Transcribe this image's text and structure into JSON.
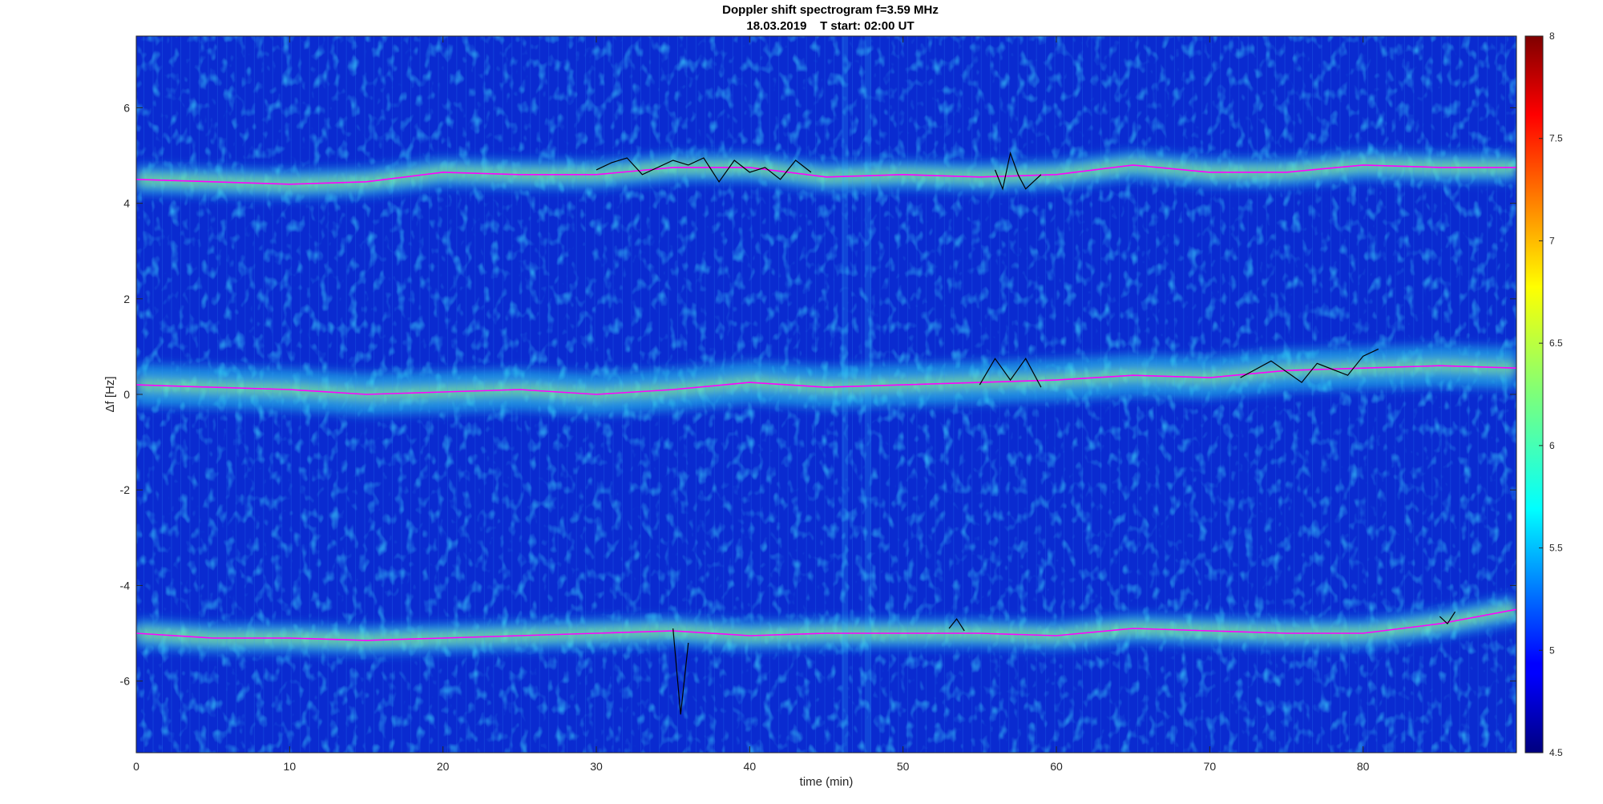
{
  "chart_data": {
    "type": "heatmap",
    "title": "Doppler shift spectrogram f=3.59 MHz",
    "subtitle": "18.03.2019    T start: 02:00 UT",
    "xlabel": "time (min)",
    "ylabel": "Δf [Hz]",
    "xlim": [
      0,
      90
    ],
    "ylim": [
      -7.5,
      7.5
    ],
    "x_ticks": [
      0,
      10,
      20,
      30,
      40,
      50,
      60,
      70,
      80
    ],
    "x_tick_labels": [
      "0",
      "10",
      "20",
      "30",
      "40",
      "50",
      "60",
      "70",
      "80"
    ],
    "y_ticks": [
      -6,
      -4,
      -2,
      0,
      2,
      4,
      6
    ],
    "y_tick_labels": [
      "-6",
      "-4",
      "-2",
      "0",
      "2",
      "4",
      "6"
    ],
    "colorbar": {
      "colormap": "jet",
      "clim": [
        4.5,
        8
      ],
      "ticks": [
        4.5,
        5,
        5.5,
        6,
        6.5,
        7,
        7.5,
        8
      ],
      "tick_labels": [
        "4.5",
        "5",
        "5.5",
        "6",
        "6.5",
        "7",
        "7.5",
        "8"
      ]
    },
    "series": [
      {
        "color": "#ff00ff",
        "x": [
          0,
          5,
          10,
          15,
          20,
          25,
          30,
          35,
          40,
          45,
          50,
          55,
          60,
          65,
          70,
          75,
          80,
          85,
          90
        ],
        "y": [
          4.5,
          4.45,
          4.4,
          4.45,
          4.65,
          4.6,
          4.6,
          4.75,
          4.75,
          4.55,
          4.6,
          4.55,
          4.6,
          4.8,
          4.65,
          4.65,
          4.8,
          4.75,
          4.75
        ]
      },
      {
        "color": "#ff00ff",
        "x": [
          0,
          5,
          10,
          15,
          20,
          25,
          30,
          35,
          40,
          45,
          50,
          55,
          60,
          65,
          70,
          75,
          80,
          85,
          90
        ],
        "y": [
          0.2,
          0.15,
          0.1,
          0.0,
          0.05,
          0.1,
          0.0,
          0.1,
          0.25,
          0.15,
          0.2,
          0.25,
          0.3,
          0.4,
          0.35,
          0.5,
          0.55,
          0.6,
          0.55
        ]
      },
      {
        "color": "#ff00ff",
        "x": [
          0,
          5,
          10,
          15,
          20,
          25,
          30,
          35,
          40,
          45,
          50,
          55,
          60,
          65,
          70,
          75,
          80,
          85,
          90
        ],
        "y": [
          -5.0,
          -5.1,
          -5.1,
          -5.15,
          -5.1,
          -5.05,
          -5.0,
          -4.95,
          -5.05,
          -5.0,
          -5.0,
          -5.0,
          -5.05,
          -4.9,
          -4.95,
          -5.0,
          -5.0,
          -4.8,
          -4.5
        ]
      },
      {
        "color": "#000000",
        "x": [
          30,
          31,
          32,
          33,
          35,
          36,
          37,
          38,
          39,
          40,
          41,
          42,
          43,
          44
        ],
        "y": [
          4.7,
          4.85,
          4.95,
          4.6,
          4.9,
          4.8,
          4.95,
          4.45,
          4.9,
          4.65,
          4.75,
          4.5,
          4.9,
          4.65
        ]
      },
      {
        "color": "#000000",
        "x": [
          35,
          35.5,
          36
        ],
        "y": [
          -4.9,
          -6.7,
          -5.2
        ]
      },
      {
        "color": "#000000",
        "x": [
          56,
          56.5,
          57,
          57.5,
          58,
          59
        ],
        "y": [
          4.7,
          4.3,
          5.05,
          4.6,
          4.3,
          4.6
        ]
      },
      {
        "color": "#000000",
        "x": [
          55,
          56,
          57,
          58,
          59
        ],
        "y": [
          0.2,
          0.75,
          0.3,
          0.75,
          0.15
        ]
      },
      {
        "color": "#000000",
        "x": [
          72,
          74,
          76,
          77,
          79,
          80,
          81
        ],
        "y": [
          0.35,
          0.7,
          0.25,
          0.65,
          0.4,
          0.8,
          0.95
        ]
      },
      {
        "color": "#000000",
        "x": [
          53,
          53.5,
          54
        ],
        "y": [
          -4.9,
          -4.7,
          -4.95
        ]
      },
      {
        "color": "#000000",
        "x": [
          85,
          85.5,
          86
        ],
        "y": [
          -4.65,
          -4.8,
          -4.55
        ]
      }
    ]
  }
}
